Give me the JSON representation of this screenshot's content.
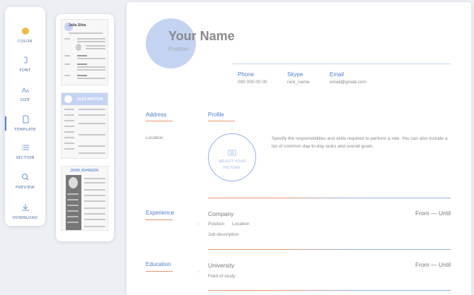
{
  "toolbar": {
    "items": [
      {
        "label": "COLOR",
        "icon": "color-dot-icon"
      },
      {
        "label": "FONT",
        "icon": "font-icon"
      },
      {
        "label": "SIZE",
        "icon": "size-icon"
      },
      {
        "label": "TEMPLATE",
        "icon": "template-icon"
      },
      {
        "label": "SECTION",
        "icon": "section-icon"
      },
      {
        "label": "PREVIEW",
        "icon": "preview-icon"
      },
      {
        "label": "DOWNLOAD",
        "icon": "download-icon"
      }
    ],
    "active": "TEMPLATE"
  },
  "templates": [
    {
      "name": "Julia Silva"
    },
    {
      "name": "ALEX MATTEW"
    },
    {
      "name": "JOHN JOHNSON"
    }
  ],
  "resume": {
    "name": "Your Name",
    "position": "Position",
    "contacts": [
      {
        "label": "Phone",
        "value": "000 000 00 00"
      },
      {
        "label": "Skype",
        "value": "nick_name"
      },
      {
        "label": "Email",
        "value": "email@gmail.com"
      }
    ],
    "address": {
      "title": "Address",
      "value": "Location"
    },
    "profile": {
      "title": "Profile",
      "text": "Specify the responsibilities and skills required to perform a role. You can also include a list of common day-to-day tasks and overall goals.",
      "picture_line1": "SELECT YOUR",
      "picture_line2": "PICTURE"
    },
    "experience": {
      "title": "Experience",
      "company": "Company",
      "position": "Position",
      "location": "Location",
      "description": "Job description",
      "dates": "From — Until"
    },
    "education": {
      "title": "Education",
      "university": "University",
      "field": "Field of study",
      "dates": "From — Until"
    }
  },
  "colors": {
    "accent_blue": "#4a7fd4",
    "accent_orange": "#e8956a",
    "avatar_fill": "#c5d3f3",
    "toolbar_dot": "#f5b942"
  }
}
